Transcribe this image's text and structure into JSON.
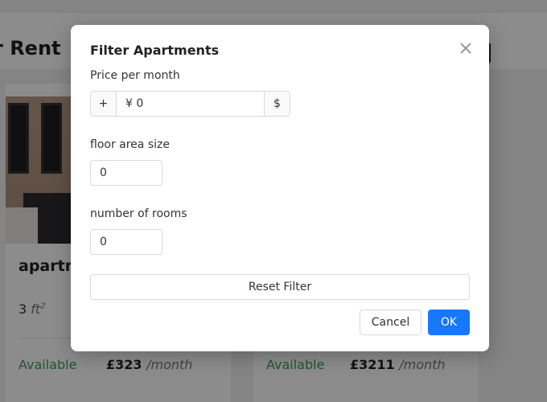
{
  "page": {
    "title_fragment": "r Rent"
  },
  "cards": [
    {
      "name": "apartm",
      "area_value": "3",
      "area_unit": "ft",
      "area_exp": "2",
      "status": "Available",
      "price": "£323",
      "per": "/month"
    },
    {
      "status": "Available",
      "price": "£3211",
      "per": "/month"
    }
  ],
  "modal": {
    "title": "Filter Apartments",
    "price_label": "Price per month",
    "price_prefix": "+",
    "price_value": "¥ 0",
    "price_suffix": "$",
    "area_label": "floor area size",
    "area_value": "0",
    "rooms_label": "number of rooms",
    "rooms_value": "0",
    "reset_label": "Reset Filter",
    "cancel_label": "Cancel",
    "ok_label": "OK"
  },
  "colors": {
    "primary": "#1677ff",
    "available": "#3d9a5b"
  },
  "icons": {
    "close": "close-icon"
  }
}
